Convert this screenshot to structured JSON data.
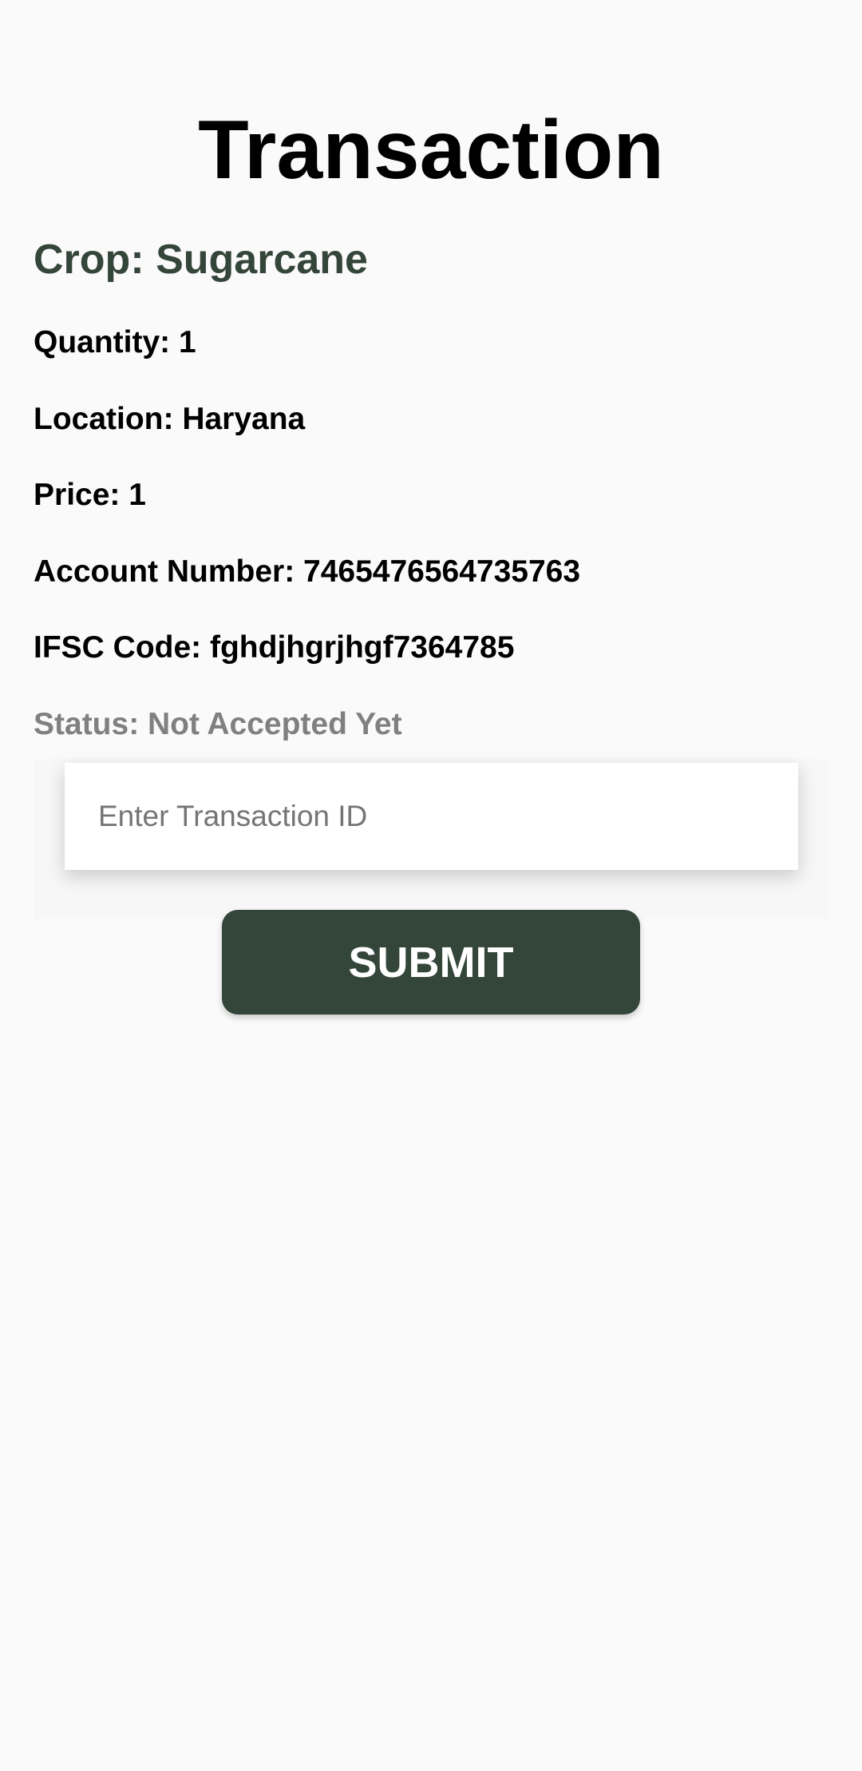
{
  "page": {
    "title": "Transaction"
  },
  "details": {
    "crop": "Crop: Sugarcane",
    "quantity": "Quantity: 1",
    "location": "Location: Haryana",
    "price": "Price: 1",
    "account_number": "Account Number: 7465476564735763",
    "ifsc_code": "IFSC Code: fghdjhgrjhgf7364785",
    "status": "Status: Not Accepted Yet"
  },
  "form": {
    "transaction_id_placeholder": "Enter Transaction ID",
    "transaction_id_value": "",
    "submit_label": "SUBMIT"
  },
  "colors": {
    "accent": "#34453a",
    "background": "#fafafa",
    "status": "#808080"
  }
}
